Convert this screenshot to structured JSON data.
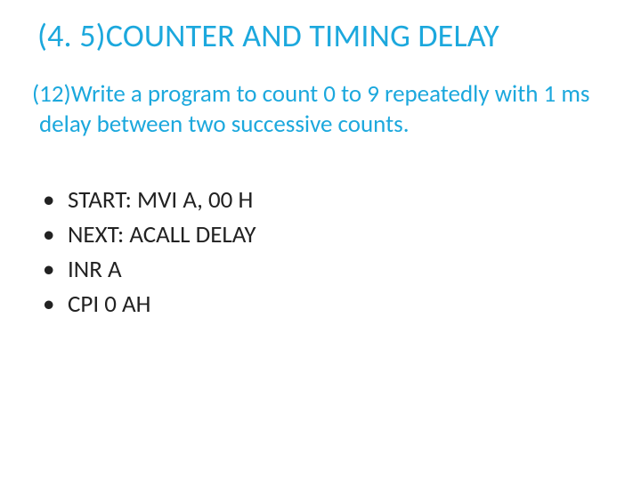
{
  "title": "(4. 5)COUNTER AND TIMING DELAY",
  "prompt": "(12)Write a program to count 0 to 9 repeatedly with 1 ms delay between two successive counts.",
  "code": [
    "START: MVI A, 00 H",
    "NEXT: ACALL DELAY",
    "INR A",
    "CPI 0 AH"
  ]
}
